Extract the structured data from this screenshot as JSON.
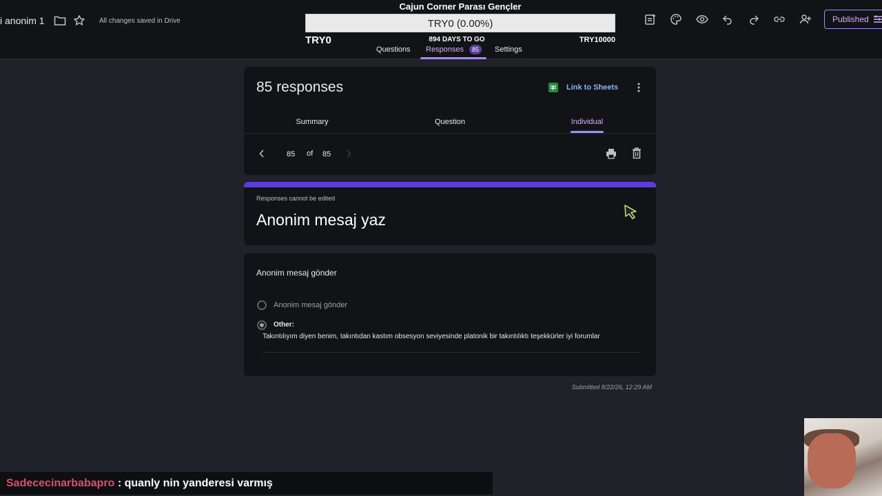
{
  "header": {
    "doc_title": "i anonim 1",
    "save_status": "All changes saved in Drive",
    "icons": [
      "folder-icon",
      "star-icon"
    ],
    "toolbar_icons": [
      "addon-icon",
      "palette-icon",
      "preview-icon",
      "undo-icon",
      "redo-icon",
      "link-icon",
      "add-collaborator-icon"
    ],
    "published_label": "Published",
    "accent_color": "#a78bfa"
  },
  "goal": {
    "title": "Cajun Corner Parası Gençler",
    "bar_text": "TRY0 (0.00%)",
    "progress": 0,
    "start_label": "TRY0",
    "days_label": "894 DAYS TO GO",
    "end_label": "TRY10000"
  },
  "form_tabs": {
    "questions": "Questions",
    "responses": "Responses",
    "responses_count": "85",
    "settings": "Settings"
  },
  "responses_card": {
    "count_text": "85 responses",
    "sheets_link": "Link to Sheets",
    "tabs": {
      "summary": "Summary",
      "question": "Question",
      "individual": "Individual"
    },
    "pager": {
      "current": "85",
      "of": "of",
      "total": "85"
    }
  },
  "form": {
    "not_editable": "Responses cannot be edited",
    "title": "Anonim mesaj yaz",
    "accent_color": "#5c3dd9"
  },
  "question": {
    "title": "Anonim mesaj gönder",
    "option_1": "Anonim mesaj gönder",
    "other_label": "Other:",
    "other_text": "Takıntılıyım diyen benim, takıntıdan kastım obsesyon seviyesinde platonik bir takıntılıktı teşekkürler iyi forumlar"
  },
  "submitted": "Submitted 8/22/26, 12:29 AM",
  "chat": {
    "user": "Sadececinarbabapro",
    "separator": " : ",
    "message": "quanly nin yanderesi varmış",
    "user_color": "#e34a6f"
  }
}
